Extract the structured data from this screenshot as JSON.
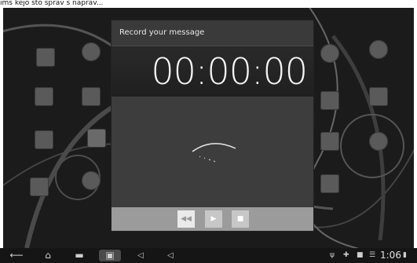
{
  "caption": "ims kejo sto sprav s naprav...",
  "dialog": {
    "title": "Record your message",
    "timer": "00:00:00",
    "controls": {
      "rewind_icon": "rewind-icon",
      "play_icon": "play-icon",
      "stop_icon": "stop-icon"
    }
  },
  "system_bar": {
    "time": "1:06",
    "icons": [
      "back-icon",
      "home-icon",
      "recent-apps-icon",
      "screenshot-icon",
      "volume-down-icon",
      "volume-up-icon",
      "usb-icon",
      "notification-icon",
      "sd-card-icon",
      "wifi-icon",
      "battery-icon"
    ]
  },
  "colors": {
    "background": "#1b1b1b",
    "dialog": "#3c3c3c",
    "timer_text": "#f5f5f5",
    "controls_bar": "#9b9b9b"
  }
}
